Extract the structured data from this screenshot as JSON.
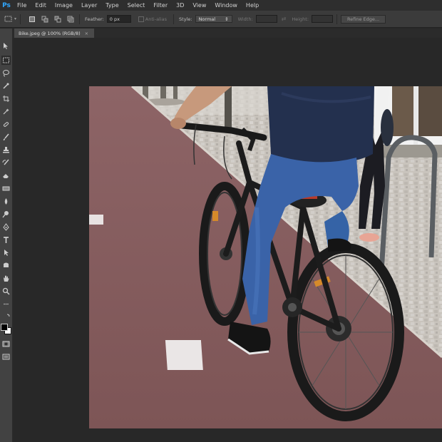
{
  "app": {
    "logo": "Ps"
  },
  "menu": [
    "File",
    "Edit",
    "Image",
    "Layer",
    "Type",
    "Select",
    "Filter",
    "3D",
    "View",
    "Window",
    "Help"
  ],
  "options": {
    "feather_label": "Feather:",
    "feather_value": "0 px",
    "antialias_label": "Anti-alias",
    "style_label": "Style:",
    "style_value": "Normal",
    "width_label": "Width:",
    "height_label": "Height:",
    "refine_button": "Refine Edge..."
  },
  "document": {
    "tab_title": "Bike.jpeg @ 100% (RGB/8)",
    "close": "×"
  },
  "tools": [
    "move-icon",
    "marquee-icon",
    "lasso-icon",
    "quick-select-icon",
    "crop-icon",
    "eyedropper-icon",
    "healing-icon",
    "brush-icon",
    "clone-stamp-icon",
    "history-brush-icon",
    "eraser-icon",
    "gradient-icon",
    "blur-icon",
    "dodge-icon",
    "pen-icon",
    "type-icon",
    "path-select-icon",
    "shape-icon",
    "hand-icon",
    "zoom-icon",
    "color-swatches-icon",
    "quick-mask-icon",
    "screen-mode-icon"
  ],
  "colors": {
    "accent": "#31a8ff",
    "chrome": "#3b3b3b",
    "pasteboard": "#282828"
  }
}
